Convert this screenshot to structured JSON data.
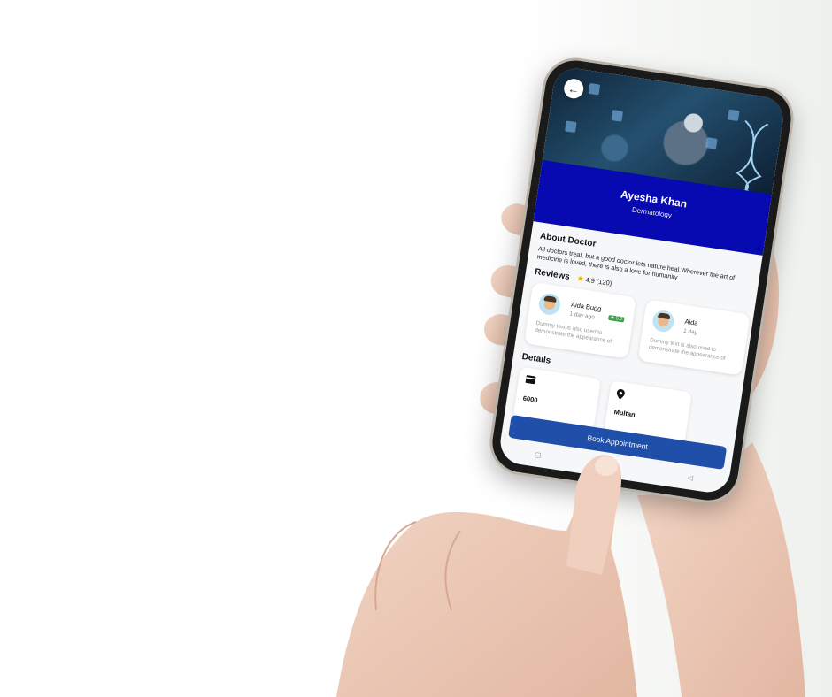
{
  "doctor": {
    "name": "Ayesha Khan",
    "specialty": "Dermatology"
  },
  "about": {
    "heading": "About Doctor",
    "text": "All doctors treat, but a good doctor lets nature heal.Wherever the art of medicine is loved, there is also a love for humanity"
  },
  "reviews": {
    "heading": "Reviews",
    "rating": "4.9",
    "count": "(120)",
    "items": [
      {
        "name": "Aida Bugg",
        "time": "1 day ago",
        "badge": "5.0",
        "text": "Dummy text is also used to demonstrate the appearance of"
      },
      {
        "name": "Aida",
        "time": "1 day",
        "text": "Dummy text is also used to demonstrate the appearance of"
      }
    ]
  },
  "details": {
    "heading": "Details",
    "fee": "6000",
    "location": "Multan"
  },
  "actions": {
    "book_label": "Book Appointment"
  },
  "icons": {
    "back": "arrow-left-icon",
    "star": "star-icon",
    "fee": "card-icon",
    "location": "location-pin-icon"
  },
  "colors": {
    "header_band": "#0709b1",
    "book_button": "#1f4fa8",
    "star": "#f3b400",
    "badge": "#3aa14a"
  }
}
